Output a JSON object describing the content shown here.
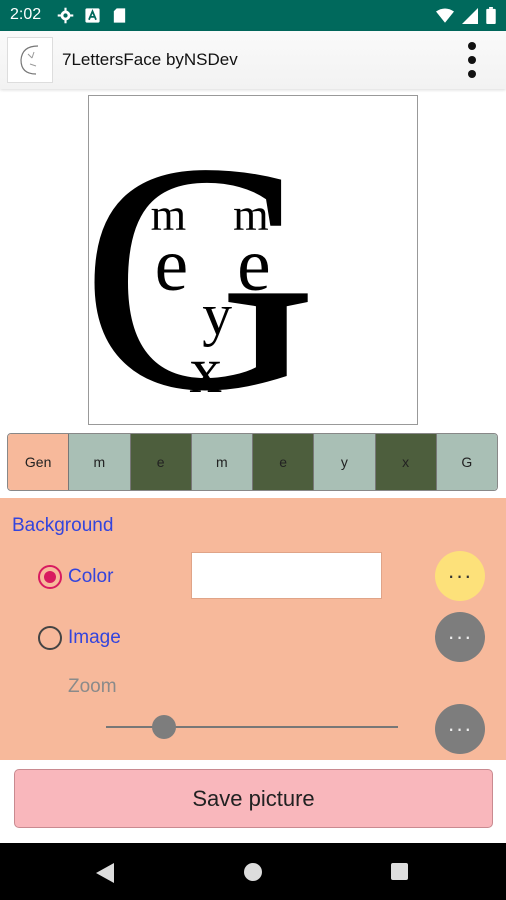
{
  "status_bar": {
    "time": "2:02",
    "icons_left": [
      "gear-icon",
      "a-icon",
      "sd-card-icon"
    ],
    "icons_right": [
      "wifi-icon",
      "signal-icon",
      "battery-icon"
    ]
  },
  "app_bar": {
    "title": "7LettersFace byNSDev",
    "menu_icon": "more-vert-icon"
  },
  "preview": {
    "letters": [
      "m",
      "m",
      "e",
      "e",
      "y",
      "x",
      "G"
    ]
  },
  "tabs": [
    {
      "label": "Gen",
      "color": "#f7b99b"
    },
    {
      "label": "m",
      "color": "#a9bfb5"
    },
    {
      "label": "e",
      "color": "#4d5e3d"
    },
    {
      "label": "m",
      "color": "#a9bfb5"
    },
    {
      "label": "e",
      "color": "#4d5e3d"
    },
    {
      "label": "y",
      "color": "#a9bfb5"
    },
    {
      "label": "x",
      "color": "#4d5e3d"
    },
    {
      "label": "G",
      "color": "#a9bfb5"
    }
  ],
  "background_panel": {
    "heading": "Background",
    "color_option": {
      "label": "Color",
      "selected": true,
      "value_color": "#ffffff"
    },
    "image_option": {
      "label": "Image",
      "selected": false
    },
    "zoom_label": "Zoom",
    "zoom_level": 0.2,
    "more_label": "···"
  },
  "save_button": {
    "label": "Save picture"
  },
  "colors": {
    "status_bar": "#00695c",
    "panel": "#f7b99b",
    "accent_text": "#3344dd",
    "radio_on": "#d81b60",
    "save_button": "#f9b7bc"
  },
  "nav_bar": {
    "icons": [
      "back-icon",
      "home-icon",
      "recents-icon"
    ]
  }
}
